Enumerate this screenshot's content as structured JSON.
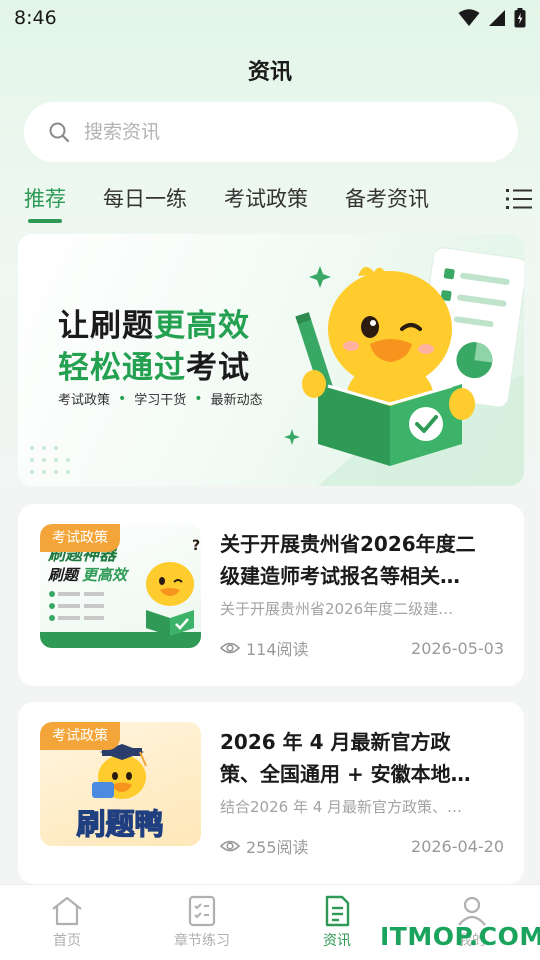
{
  "status_bar": {
    "time": "8:46"
  },
  "header": {
    "title": "资讯"
  },
  "search": {
    "placeholder": "搜索资讯"
  },
  "tabs": [
    {
      "label": "推荐",
      "active": true
    },
    {
      "label": "每日一练",
      "active": false
    },
    {
      "label": "考试政策",
      "active": false
    },
    {
      "label": "备考资讯",
      "active": false
    }
  ],
  "banner": {
    "line1_prefix": "让刷题",
    "line1_highlight": "更高效",
    "line2_prefix": "轻松通过",
    "line2_suffix": "考试",
    "sub_items": [
      "考试政策",
      "学习干货",
      "最新动态"
    ]
  },
  "news": [
    {
      "tag": "考试政策",
      "title_line1": "关于开展贵州省2026年度二",
      "title_line2": "级建造师考试报名等相关…",
      "summary": "关于开展贵州省2026年度二级建…",
      "reads": "114阅读",
      "date": "2026-05-03",
      "thumb_text_a": "刷题神器",
      "thumb_text_b": "刷题",
      "thumb_text_c": "更高效"
    },
    {
      "tag": "考试政策",
      "title_line1": "2026 年 4 月最新官方政",
      "title_line2": "策、全国通用 + 安徽本地…",
      "summary": "结合2026 年 4 月最新官方政策、…",
      "reads": "255阅读",
      "date": "2026-04-20",
      "thumb_text_a": "刷题鸭"
    }
  ],
  "bottom_nav": [
    {
      "label": "首页",
      "active": false
    },
    {
      "label": "章节练习",
      "active": false
    },
    {
      "label": "资讯",
      "active": true
    },
    {
      "label": "我的",
      "active": false
    }
  ],
  "watermark": "ITMOP.COM",
  "colors": {
    "accent": "#2e9a55",
    "tag": "#f3a53a",
    "duck": "#ffcc2e"
  }
}
